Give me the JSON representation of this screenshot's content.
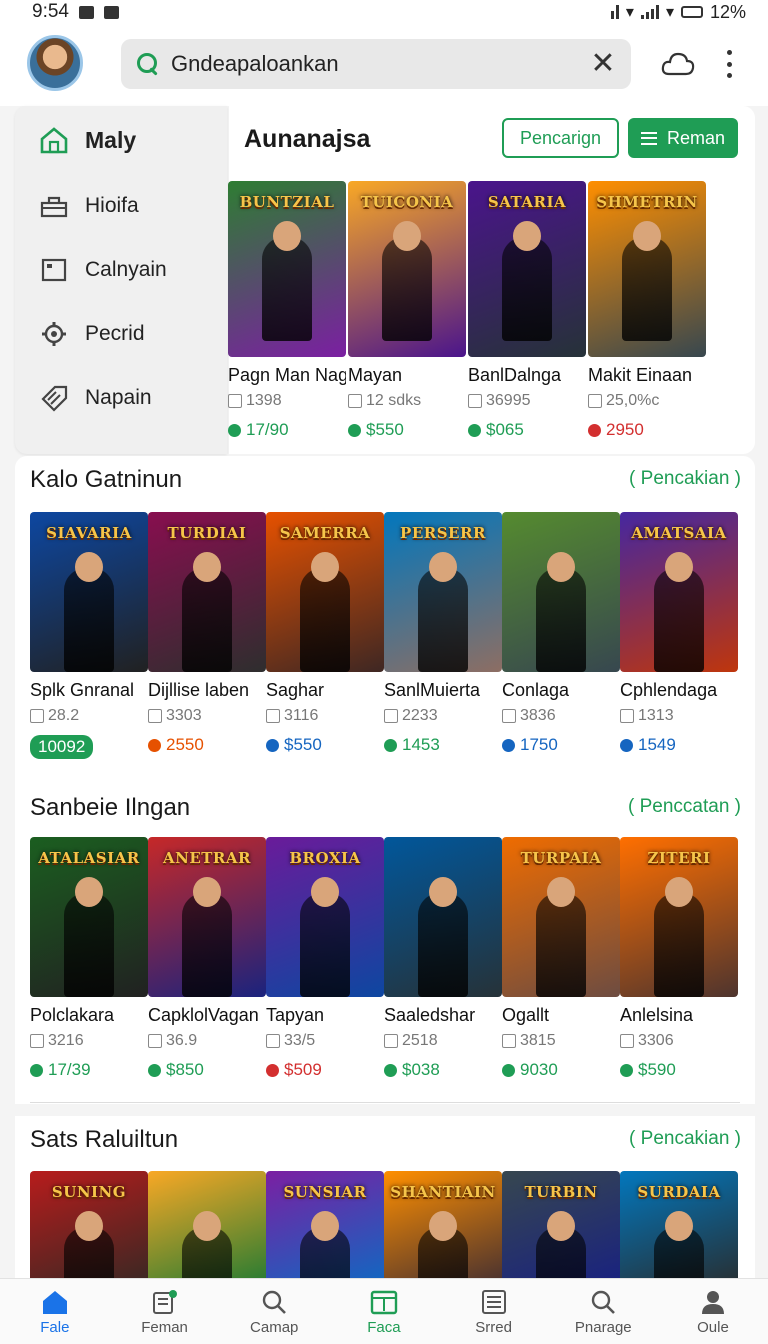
{
  "status_bar": {
    "time": "9:54",
    "battery": "12%"
  },
  "header": {
    "search_value": "Gndeapaloankan",
    "search_placeholder": "Search"
  },
  "sidebar": {
    "items": [
      {
        "label": "Maly",
        "icon": "home-icon",
        "active": true
      },
      {
        "label": "Hioifa",
        "icon": "briefcase-icon",
        "active": false
      },
      {
        "label": "Calnyain",
        "icon": "square-icon",
        "active": false
      },
      {
        "label": "Pecrid",
        "icon": "gear-icon",
        "active": false
      },
      {
        "label": "Napain",
        "icon": "tag-icon",
        "active": false
      }
    ]
  },
  "featured": {
    "title": "Aunanajsa",
    "outline_button": "Pencarign",
    "solid_button": "Reman",
    "cards": [
      {
        "name": "Pagn Man Nagan",
        "meta": "1398",
        "price": "17/90",
        "price_color": "#1f9d55",
        "logo": "BUNTZIAL",
        "art": [
          "#2e7d32",
          "#7b1fa2"
        ]
      },
      {
        "name": "Mayan",
        "meta": "12 sdks",
        "price": "$550",
        "price_color": "#1f9d55",
        "logo": "TUICONIA",
        "art": [
          "#f9a825",
          "#4a148c"
        ]
      },
      {
        "name": "BanlDalnga",
        "meta": "36995",
        "price": "$065",
        "price_color": "#1f9d55",
        "logo": "SATARIA",
        "art": [
          "#4a148c",
          "#263238"
        ]
      },
      {
        "name": "Makit Einaan",
        "meta": "25,0%c",
        "price": "2950",
        "price_color": "#d32f2f",
        "logo": "SHMETRIN",
        "art": [
          "#ff8f00",
          "#37474f"
        ]
      }
    ]
  },
  "sections": [
    {
      "title": "Kalo Gatninun",
      "link": "Pencakian",
      "cards": [
        {
          "name": "Splk Gnranal",
          "meta": "28.2",
          "price": "10092",
          "price_color": "#1f9d55",
          "pill": true,
          "logo": "SIAVARIA",
          "art": [
            "#0d47a1",
            "#212121"
          ]
        },
        {
          "name": "Dijllise laben",
          "meta": "3303",
          "price": "2550",
          "price_color": "#e65100",
          "pill": false,
          "logo": "TURDIAI",
          "art": [
            "#880e4f",
            "#2e2e2e"
          ]
        },
        {
          "name": "Saghar",
          "meta": "3116",
          "price": "$550",
          "price_color": "#1565c0",
          "pill": false,
          "logo": "SAMERRA",
          "art": [
            "#e65100",
            "#3e2723"
          ]
        },
        {
          "name": "SanlMuierta",
          "meta": "2233",
          "price": "1453",
          "price_color": "#1f9d55",
          "pill": false,
          "logo": "PERSERR",
          "art": [
            "#0277bd",
            "#8d6e63"
          ]
        },
        {
          "name": "Conlaga",
          "meta": "3836",
          "price": "1750",
          "price_color": "#1565c0",
          "pill": false,
          "logo": "",
          "art": [
            "#558b2f",
            "#37474f"
          ]
        },
        {
          "name": "Cphlendaga",
          "meta": "1313",
          "price": "1549",
          "price_color": "#1565c0",
          "pill": false,
          "logo": "AMATSAIA",
          "art": [
            "#4527a0",
            "#bf360c"
          ]
        }
      ]
    },
    {
      "title": "Sanbeie Ilngan",
      "link": "Penccatan",
      "cards": [
        {
          "name": "Polclakara",
          "meta": "3216",
          "price": "17/39",
          "price_color": "#1f9d55",
          "pill": false,
          "logo": "ATALASIAR",
          "art": [
            "#1b5e20",
            "#212121"
          ]
        },
        {
          "name": "CapklolVagan",
          "meta": "36.9",
          "price": "$850",
          "price_color": "#1f9d55",
          "pill": false,
          "logo": "ANETRAR",
          "art": [
            "#c62828",
            "#1a237e"
          ]
        },
        {
          "name": "Tapyan",
          "meta": "33/5",
          "price": "$509",
          "price_color": "#d32f2f",
          "pill": false,
          "logo": "BROXIA",
          "art": [
            "#6a1b9a",
            "#0d47a1"
          ]
        },
        {
          "name": "Saaledshar",
          "meta": "2518",
          "price": "$038",
          "price_color": "#1f9d55",
          "pill": false,
          "logo": "",
          "art": [
            "#01579b",
            "#263238"
          ]
        },
        {
          "name": "Ogallt",
          "meta": "3815",
          "price": "9030",
          "price_color": "#1f9d55",
          "pill": false,
          "logo": "TURPAIA",
          "art": [
            "#ef6c00",
            "#6d4c41"
          ]
        },
        {
          "name": "Anlelsina",
          "meta": "3306",
          "price": "$590",
          "price_color": "#1f9d55",
          "pill": false,
          "logo": "ZITERI",
          "art": [
            "#ff6f00",
            "#4e342e"
          ]
        }
      ]
    },
    {
      "title": "Sats Raluiltun",
      "link": "Pencakian",
      "cards": [
        {
          "logo": "SUNING",
          "art": [
            "#b71c1c",
            "#3e2723"
          ]
        },
        {
          "logo": "",
          "art": [
            "#f9a825",
            "#2e7d32"
          ]
        },
        {
          "logo": "SUNSIAR",
          "art": [
            "#7b1fa2",
            "#1565c0"
          ]
        },
        {
          "logo": "SHANTIAIN",
          "art": [
            "#ff8f00",
            "#4e342e"
          ]
        },
        {
          "logo": "TURBIN",
          "art": [
            "#37474f",
            "#1a237e"
          ]
        },
        {
          "logo": "SURDAIA",
          "art": [
            "#0277bd",
            "#263238"
          ]
        }
      ]
    }
  ],
  "bottom_nav": [
    {
      "label": "Fale",
      "icon": "home-icon",
      "state": "active"
    },
    {
      "label": "Feman",
      "icon": "notes-icon",
      "state": ""
    },
    {
      "label": "Camap",
      "icon": "search-icon",
      "state": ""
    },
    {
      "label": "Faca",
      "icon": "calendar-icon",
      "state": "green"
    },
    {
      "label": "Srred",
      "icon": "list-icon",
      "state": ""
    },
    {
      "label": "Pnarage",
      "icon": "search-icon",
      "state": ""
    },
    {
      "label": "Oule",
      "icon": "person-icon",
      "state": ""
    }
  ]
}
